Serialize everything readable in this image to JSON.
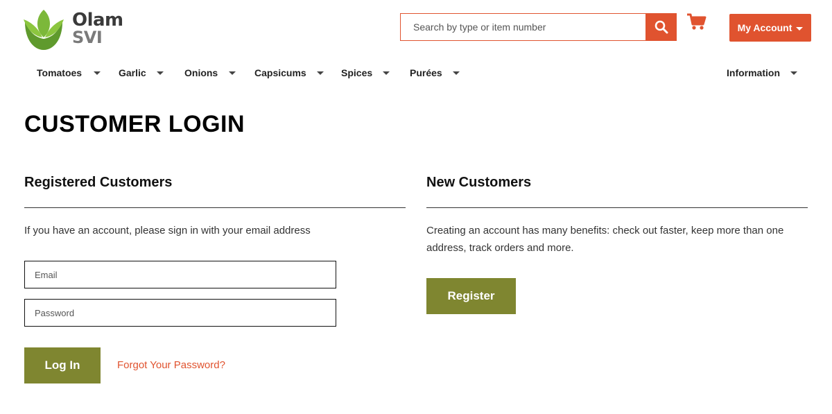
{
  "brand": {
    "line1": "Olam",
    "line2": "SVI",
    "colors": {
      "accent": "#e0532f",
      "olive": "#7f8630",
      "leaf_green": "#6a9b2e"
    }
  },
  "header": {
    "search": {
      "placeholder": "Search by type or item number",
      "value": ""
    },
    "search_icon": "search-icon",
    "cart_icon": "shopping-cart-icon",
    "account_label": "My Account"
  },
  "nav": {
    "items": [
      {
        "label": "Tomatoes"
      },
      {
        "label": "Garlic"
      },
      {
        "label": "Onions"
      },
      {
        "label": "Capsicums"
      },
      {
        "label": "Spices"
      },
      {
        "label": "Purées"
      },
      {
        "label": "Information"
      }
    ]
  },
  "main": {
    "title": "CUSTOMER LOGIN",
    "registered": {
      "title": "Registered Customers",
      "text": "If you have an account, please sign in with your email address",
      "email_placeholder": "Email",
      "password_placeholder": "Password",
      "login_label": "Log In",
      "forgot_label": "Forgot Your Password?"
    },
    "new_customers": {
      "title": "New Customers",
      "text": "Creating an account has many benefits: check out faster, keep more than one address, track orders and more.",
      "register_label": "Register"
    }
  }
}
